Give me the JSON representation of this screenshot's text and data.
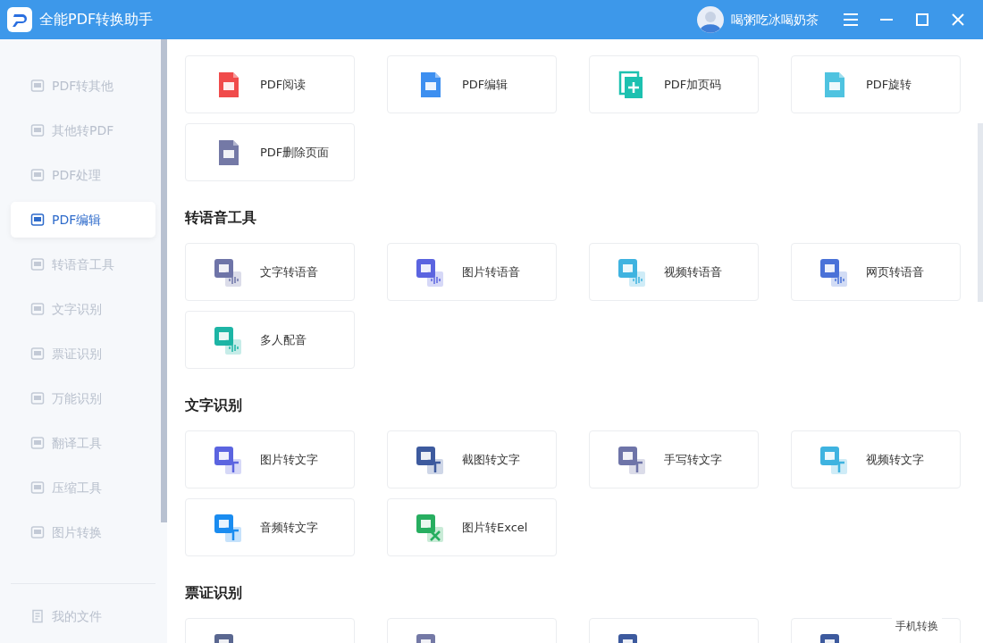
{
  "window": {
    "title": "全能PDF转换助手",
    "user": "喝粥吃冰喝奶茶"
  },
  "sidebar": {
    "items": [
      {
        "label": "PDF转其他",
        "selected": false
      },
      {
        "label": "其他转PDF",
        "selected": false
      },
      {
        "label": "PDF处理",
        "selected": false
      },
      {
        "label": "PDF编辑",
        "selected": true
      },
      {
        "label": "转语音工具",
        "selected": false
      },
      {
        "label": "文字识别",
        "selected": false
      },
      {
        "label": "票证识别",
        "selected": false
      },
      {
        "label": "万能识别",
        "selected": false
      },
      {
        "label": "翻译工具",
        "selected": false
      },
      {
        "label": "压缩工具",
        "selected": false
      },
      {
        "label": "图片转换",
        "selected": false
      }
    ],
    "footer": "我的文件"
  },
  "sections": [
    {
      "cards": [
        {
          "label": "PDF阅读",
          "kind": "file",
          "color": "#f04b4b"
        },
        {
          "label": "PDF编辑",
          "kind": "file",
          "color": "#3d8ff0"
        },
        {
          "label": "PDF加页码",
          "kind": "pages",
          "color": "#1cc1b0"
        },
        {
          "label": "PDF旋转",
          "kind": "file",
          "color": "#4fc3e0"
        },
        {
          "label": "PDF删除页面",
          "kind": "file",
          "color": "#7479a6"
        }
      ]
    },
    {
      "title": "转语音工具",
      "cards": [
        {
          "label": "文字转语音",
          "kind": "voice",
          "color": "#6e74a8"
        },
        {
          "label": "图片转语音",
          "kind": "voice",
          "color": "#5b64e0"
        },
        {
          "label": "视频转语音",
          "kind": "voice",
          "color": "#3fb3e0"
        },
        {
          "label": "网页转语音",
          "kind": "voice",
          "color": "#4a72d8"
        },
        {
          "label": "多人配音",
          "kind": "voice",
          "color": "#1db5a5"
        }
      ]
    },
    {
      "title": "文字识别",
      "cards": [
        {
          "label": "图片转文字",
          "kind": "text",
          "color": "#5b64e0"
        },
        {
          "label": "截图转文字",
          "kind": "text",
          "color": "#3d5a9e"
        },
        {
          "label": "手写转文字",
          "kind": "text",
          "color": "#6e74a8"
        },
        {
          "label": "视频转文字",
          "kind": "text",
          "color": "#3fb3e0"
        },
        {
          "label": "音频转文字",
          "kind": "text",
          "color": "#1a8cf0"
        },
        {
          "label": "图片转Excel",
          "kind": "excel",
          "color": "#27ae60"
        }
      ]
    },
    {
      "title": "票证识别",
      "cards": [
        {
          "kind": "tile",
          "color": "#5a6790"
        },
        {
          "kind": "tile",
          "color": "#7479a6"
        },
        {
          "kind": "tile",
          "color": "#3d5a9e"
        },
        {
          "kind": "tile",
          "color": "#3d5a9e"
        }
      ]
    }
  ],
  "floating_button": "手机转换"
}
